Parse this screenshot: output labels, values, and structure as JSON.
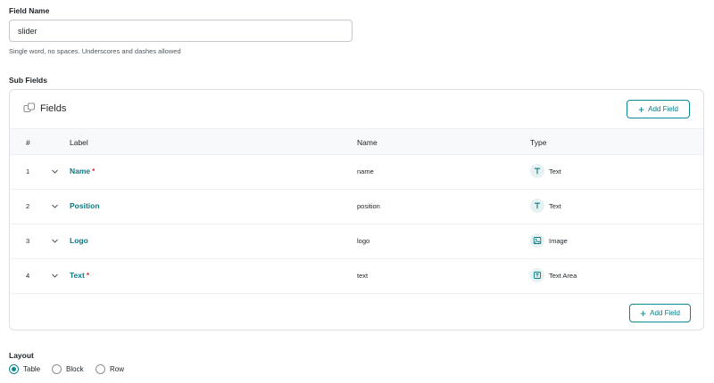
{
  "field_name": {
    "label": "Field Name",
    "value": "slider",
    "help": "Single word, no spaces. Underscores and dashes allowed"
  },
  "sub_fields": {
    "label": "Sub Fields",
    "panel_title": "Fields",
    "add_button_top": "Add Field",
    "add_button_bottom": "Add Field",
    "columns": {
      "num": "#",
      "label": "Label",
      "name": "Name",
      "type": "Type"
    },
    "rows": [
      {
        "num": "1",
        "label": "Name",
        "required": "*",
        "name": "name",
        "type": "Text",
        "type_icon": "text-icon"
      },
      {
        "num": "2",
        "label": "Position",
        "required": "",
        "name": "position",
        "type": "Text",
        "type_icon": "text-icon"
      },
      {
        "num": "3",
        "label": "Logo",
        "required": "",
        "name": "logo",
        "type": "Image",
        "type_icon": "image-icon"
      },
      {
        "num": "4",
        "label": "Text",
        "required": "*",
        "name": "text",
        "type": "Text Area",
        "type_icon": "textarea-icon"
      }
    ]
  },
  "layout": {
    "label": "Layout",
    "options": [
      {
        "label": "Table",
        "checked": true
      },
      {
        "label": "Block",
        "checked": false
      },
      {
        "label": "Row",
        "checked": false
      }
    ]
  },
  "colors": {
    "accent": "#0a8a90",
    "required": "#d63638"
  }
}
